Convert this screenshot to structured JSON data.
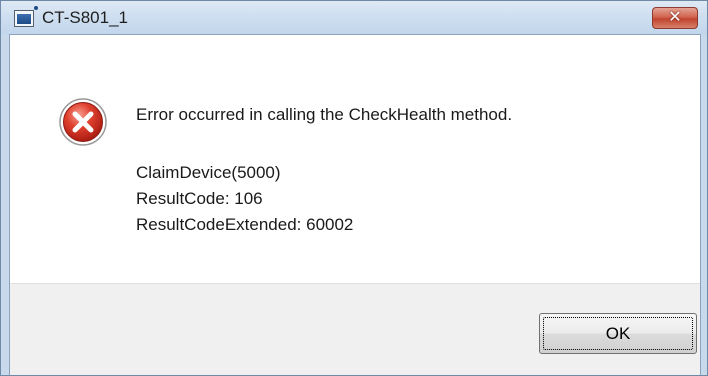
{
  "window": {
    "title": "CT-S801_1",
    "close_glyph": "✕"
  },
  "icons": {
    "app": "app-window-icon",
    "close": "close-icon",
    "error": "error-icon"
  },
  "message": {
    "headline": "Error occurred in calling the CheckHealth method.",
    "details": [
      "ClaimDevice(5000)",
      "ResultCode: 106",
      "ResultCodeExtended: 60002"
    ]
  },
  "buttons": {
    "ok_label": "OK"
  },
  "colors": {
    "error_red": "#d42a1c",
    "titlebar": "#c9d9ec",
    "close_button": "#c7432f",
    "button_area": "#f0f0f0"
  }
}
